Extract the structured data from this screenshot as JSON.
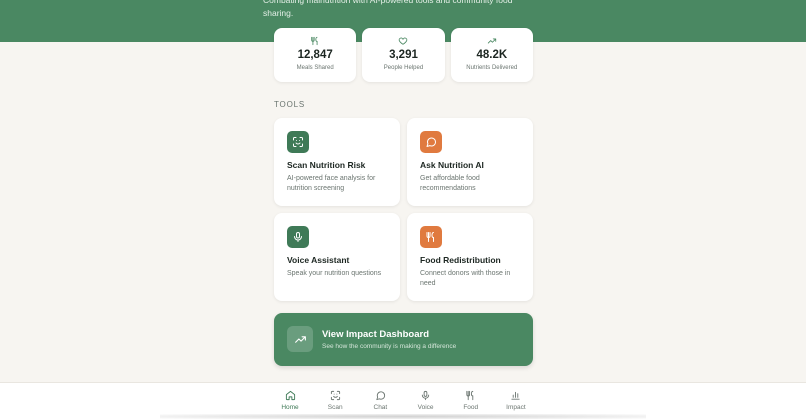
{
  "hero": {
    "tagline": "Combating malnutrition with AI-powered tools and community food sharing.",
    "color": "#4a8862"
  },
  "stats": [
    {
      "icon": "utensils-icon",
      "value": "12,847",
      "label": "Meals Shared"
    },
    {
      "icon": "heart-icon",
      "value": "3,291",
      "label": "People Helped"
    },
    {
      "icon": "trending-up-icon",
      "value": "48.2K",
      "label": "Nutrients Delivered"
    }
  ],
  "tools_section": {
    "title": "TOOLS",
    "items": [
      {
        "icon": "face-scan-icon",
        "color": "#3f7a57",
        "title": "Scan Nutrition Risk",
        "description": "AI-powered face analysis for nutrition screening"
      },
      {
        "icon": "chat-bubble-icon",
        "color": "#e07a3f",
        "title": "Ask Nutrition AI",
        "description": "Get affordable food recommendations"
      },
      {
        "icon": "microphone-icon",
        "color": "#3f7a57",
        "title": "Voice Assistant",
        "description": "Speak your nutrition questions"
      },
      {
        "icon": "utensils-icon",
        "color": "#e07a3f",
        "title": "Food Redistribution",
        "description": "Connect donors with those in need"
      }
    ]
  },
  "impact_card": {
    "icon": "trending-up-icon",
    "title": "View Impact Dashboard",
    "subtitle": "See how the community is making a difference"
  },
  "bottom_nav": {
    "active": "Home",
    "items": [
      {
        "icon": "home-icon",
        "label": "Home"
      },
      {
        "icon": "scan-icon",
        "label": "Scan"
      },
      {
        "icon": "chat-bubble-icon",
        "label": "Chat"
      },
      {
        "icon": "microphone-icon",
        "label": "Voice"
      },
      {
        "icon": "utensils-icon",
        "label": "Food"
      },
      {
        "icon": "bar-chart-icon",
        "label": "Impact"
      }
    ]
  }
}
